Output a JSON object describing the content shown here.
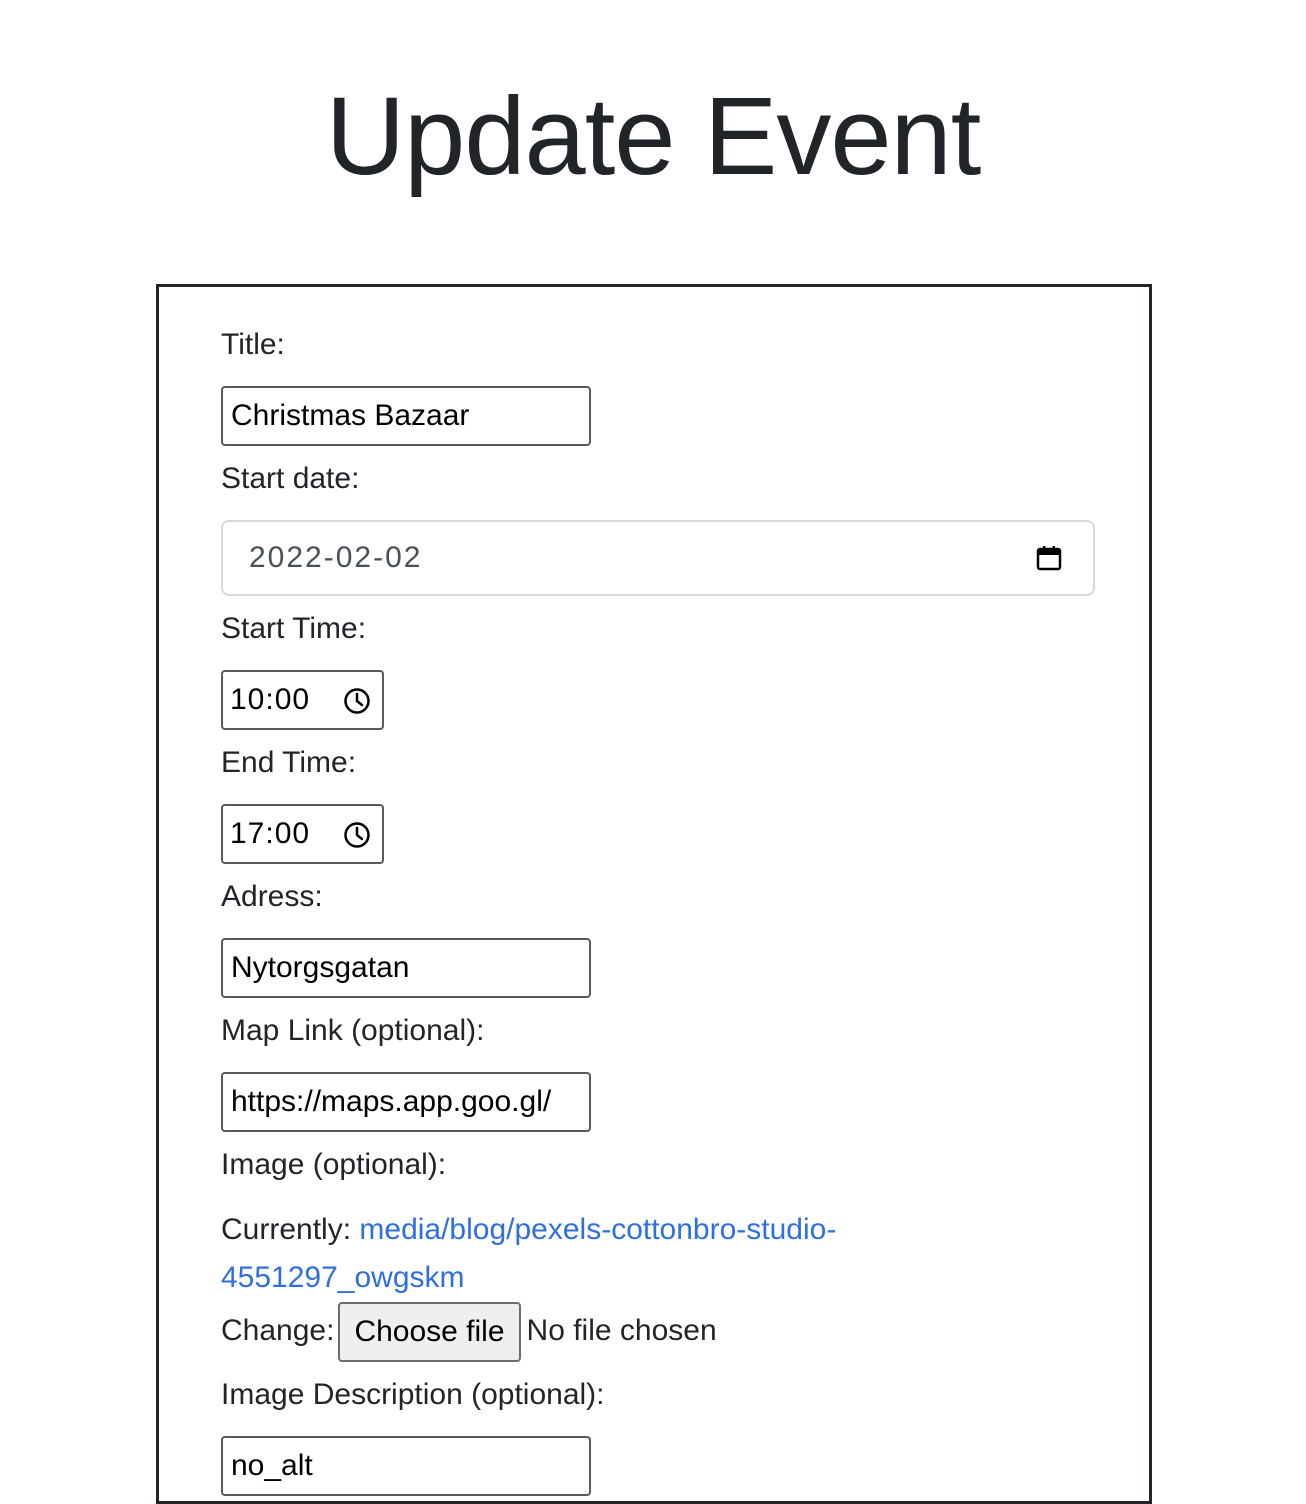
{
  "page": {
    "title": "Update Event"
  },
  "form": {
    "title_label": "Title:",
    "title_value": "Christmas Bazaar",
    "start_date_label": "Start date:",
    "start_date_value": "2022-02-02",
    "start_time_label": "Start Time:",
    "start_time_value": "10:00",
    "end_time_label": "End Time:",
    "end_time_value": "17:00",
    "address_label": "Adress:",
    "address_value": "Nytorgsgatan",
    "map_link_label": "Map Link (optional):",
    "map_link_value": "https://maps.app.goo.gl/",
    "image_label": "Image (optional):",
    "currently_label": "Currently:",
    "current_image_link": "media/blog/pexels-cottonbro-studio-4551297_owgskm",
    "change_label": "Change:",
    "choose_file_label": "Choose file",
    "no_file_text": "No file chosen",
    "image_desc_label": "Image Description (optional):",
    "image_desc_value": "no_alt"
  },
  "icons": {
    "calendar": "calendar-icon",
    "clock": "clock-icon"
  },
  "colors": {
    "link": "#2f6fdf",
    "text": "#212529",
    "border": "#212529"
  }
}
